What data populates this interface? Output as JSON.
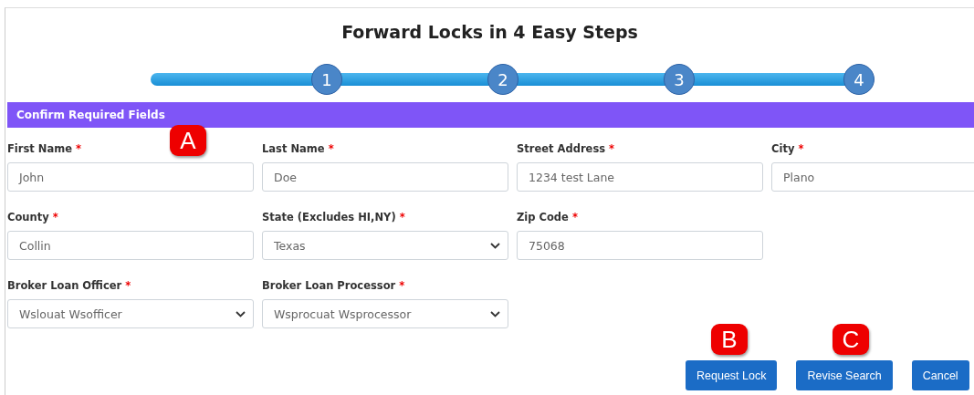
{
  "title": "Forward Locks in 4 Easy Steps",
  "steps": [
    {
      "label": "1"
    },
    {
      "label": "2"
    },
    {
      "label": "3"
    },
    {
      "label": "4"
    }
  ],
  "section": {
    "title": "Confirm Required Fields"
  },
  "fields": [
    {
      "label": "First Name",
      "required": "*",
      "kind": "input",
      "value": "John"
    },
    {
      "label": "Last Name",
      "required": "*",
      "kind": "input",
      "value": "Doe"
    },
    {
      "label": "Street Address",
      "required": "*",
      "kind": "input",
      "value": "1234 test Lane"
    },
    {
      "label": "City",
      "required": "*",
      "kind": "input",
      "value": "Plano"
    },
    {
      "label": "County",
      "required": "*",
      "kind": "input",
      "value": "Collin"
    },
    {
      "label": "State (Excludes HI,NY)",
      "required": "*",
      "kind": "select",
      "value": "Texas"
    },
    {
      "label": "Zip Code",
      "required": "*",
      "kind": "input",
      "value": "75068"
    },
    {
      "kind": "empty"
    },
    {
      "label": "Broker Loan Officer",
      "required": "*",
      "kind": "select",
      "value": "Wslouat Wsofficer"
    },
    {
      "label": "Broker Loan Processor",
      "required": "*",
      "kind": "select",
      "value": "Wsprocuat Wsprocessor"
    }
  ],
  "buttons": [
    {
      "label": "Request Lock"
    },
    {
      "label": "Revise Search"
    },
    {
      "label": "Cancel"
    }
  ],
  "callouts": [
    {
      "label": "A"
    },
    {
      "label": "B"
    },
    {
      "label": "C"
    }
  ]
}
